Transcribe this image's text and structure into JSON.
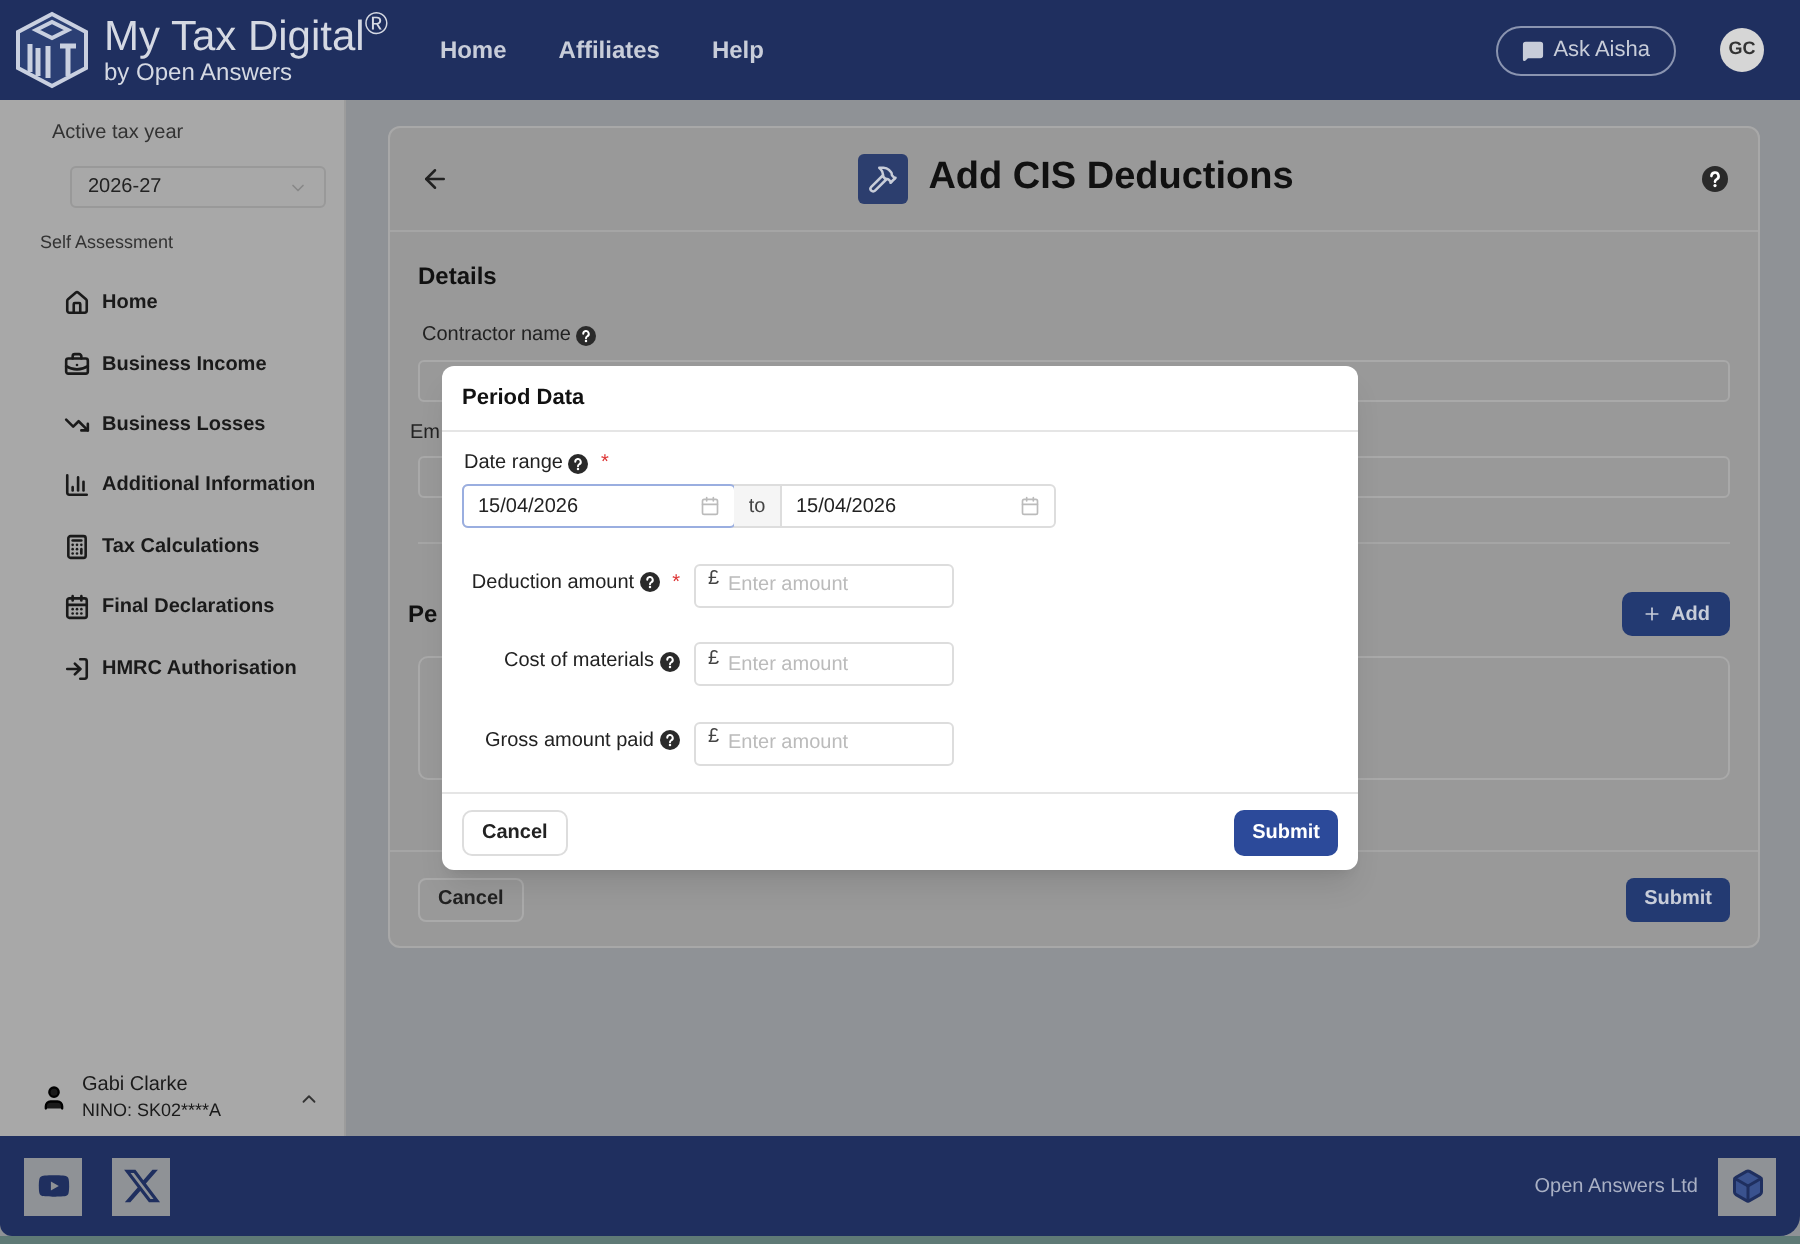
{
  "brand": {
    "name": "My Tax Digital$^{®}$",
    "byline": "by Open Answers"
  },
  "nav": [
    "Home",
    "Affiliates",
    "Help"
  ],
  "ask_button": "Ask Aisha",
  "avatar": "GC",
  "sidebar": {
    "tax_year_label": "Active tax year",
    "tax_year": "2026-27",
    "section": "Self Assessment",
    "items": [
      {
        "label": "Home",
        "kind": "home"
      },
      {
        "label": "Business Income",
        "kind": "briefcase"
      },
      {
        "label": "Business Losses",
        "kind": "trend"
      },
      {
        "label": "Additional Information",
        "kind": "chart"
      },
      {
        "label": "Tax Calculations",
        "kind": "calculator"
      },
      {
        "label": "Final Declarations",
        "kind": "calendar"
      },
      {
        "label": "HMRC Authorisation",
        "kind": "login"
      }
    ],
    "user": {
      "name": "Gabi Clarke",
      "nino": "NINO: SK02****A"
    }
  },
  "page": {
    "title": "Add CIS Deductions",
    "details_heading": "Details",
    "contractor_label": "Contractor name",
    "second_label": "Em",
    "second_heading": "Pe",
    "add_button": "Add",
    "cancel_button": "Cancel",
    "submit_button": "Submit"
  },
  "modal": {
    "title": "Period Data",
    "date_label": "Date range",
    "date_required_mark": "*",
    "date_from": "15/04/2026",
    "to_label": "to",
    "date_to": "15/04/2026",
    "fields": [
      {
        "label": "Deduction amount",
        "required_mark": "*",
        "currency": "£",
        "placeholder": "Enter amount"
      },
      {
        "label": "Cost of materials",
        "currency": "£",
        "placeholder": "Enter amount"
      },
      {
        "label": "Gross amount paid",
        "currency": "£",
        "placeholder": "Enter amount"
      }
    ],
    "cancel_button": "Cancel",
    "submit_button": "Submit"
  },
  "footer": {
    "company": "Open Answers Ltd"
  }
}
